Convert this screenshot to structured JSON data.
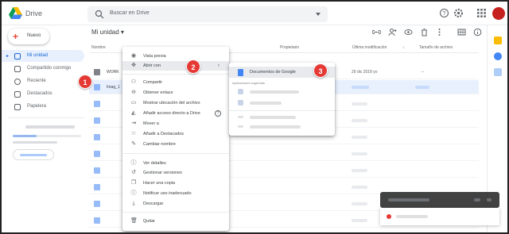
{
  "app": {
    "brand": "Drive",
    "search_placeholder": "Buscar en Drive"
  },
  "sidebar": {
    "new_label": "Nuevo",
    "items": [
      {
        "label": "Mi unidad",
        "active": true
      },
      {
        "label": "Compartido conmigo"
      },
      {
        "label": "Reciente"
      },
      {
        "label": "Destacados"
      },
      {
        "label": "Papelera"
      }
    ]
  },
  "main": {
    "title": "Mi unidad",
    "columns": {
      "name": "Nombre",
      "owner": "Propietario",
      "modified": "Última modificación",
      "size": "Tamaño de archivo"
    },
    "rows": [
      {
        "name": "WORK",
        "type": "folder",
        "date": "29 dic 2018 yo",
        "size": "–"
      },
      {
        "name": "Imag_1",
        "type": "image",
        "selected": true
      }
    ]
  },
  "context_menu": {
    "items": [
      {
        "icon": "eye-icon",
        "label": "Vista previa"
      },
      {
        "icon": "move-icon",
        "label": "Abrir con",
        "has_submenu": true,
        "highlighted": true
      },
      {
        "icon": "person-add-icon",
        "label": "Compartir"
      },
      {
        "icon": "link-icon",
        "label": "Obtener enlace"
      },
      {
        "icon": "folder-icon",
        "label": "Mostrar ubicación del archivo"
      },
      {
        "icon": "drive-shortcut-icon",
        "label": "Añadir acceso directo a Drive",
        "help": true
      },
      {
        "icon": "move-to-icon",
        "label": "Mover a"
      },
      {
        "icon": "star-icon",
        "label": "Añadir a Destacados"
      },
      {
        "icon": "pencil-icon",
        "label": "Cambiar nombre"
      },
      {
        "icon": "info-icon",
        "label": "Ver detalles"
      },
      {
        "icon": "history-icon",
        "label": "Gestionar versiones"
      },
      {
        "icon": "copy-icon",
        "label": "Hacer una copia"
      },
      {
        "icon": "report-icon",
        "label": "Notificar uso inadecuado"
      },
      {
        "icon": "download-icon",
        "label": "Descargar"
      },
      {
        "icon": "trash-icon",
        "label": "Quitar"
      }
    ],
    "help_glyph": "?",
    "arrow_glyph": "›"
  },
  "submenu": {
    "primary": "Documentos de Google",
    "section_label": "Aplicaciones sugeridas"
  },
  "markers": [
    "1",
    "2",
    "3"
  ],
  "colors": {
    "accent": "#1a73e8",
    "marker": "#e53935",
    "highlight": "#e8eaed",
    "selected_row": "#e8f0fe"
  }
}
